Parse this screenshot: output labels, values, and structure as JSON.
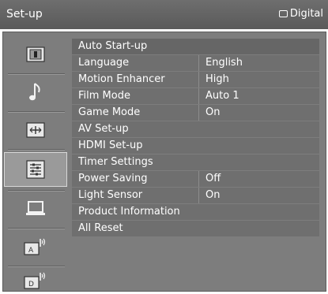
{
  "header": {
    "title": "Set-up",
    "source_label": "Digital",
    "source_icon": "screen-outline-icon"
  },
  "sidebar": {
    "items": [
      {
        "name": "picture",
        "icon": "picture-icon"
      },
      {
        "name": "sound",
        "icon": "music-note-icon"
      },
      {
        "name": "screen",
        "icon": "screen-adjust-icon"
      },
      {
        "name": "setup",
        "icon": "setup-list-icon",
        "selected": true
      },
      {
        "name": "pc",
        "icon": "laptop-icon"
      },
      {
        "name": "analog-tuning",
        "icon": "analog-antenna-icon"
      },
      {
        "name": "digital-tuning",
        "icon": "digital-antenna-icon"
      }
    ]
  },
  "menu": {
    "rows": [
      {
        "label": "Auto Start-up",
        "value": ""
      },
      {
        "label": "Language",
        "value": "English"
      },
      {
        "label": "Motion Enhancer",
        "value": "High"
      },
      {
        "label": "Film Mode",
        "value": "Auto 1"
      },
      {
        "label": "Game Mode",
        "value": "On"
      },
      {
        "label": "AV Set-up",
        "value": ""
      },
      {
        "label": "HDMI Set-up",
        "value": ""
      },
      {
        "label": "Timer Settings",
        "value": ""
      },
      {
        "label": "Power Saving",
        "value": "Off"
      },
      {
        "label": "Light Sensor",
        "value": "On"
      },
      {
        "label": "Product Information",
        "value": ""
      },
      {
        "label": "All Reset",
        "value": ""
      }
    ]
  },
  "colors": {
    "titlebar": "#5f5f5f",
    "panel": "#7d7d7d",
    "row": "#6f6f6f",
    "text": "#ffffff"
  }
}
